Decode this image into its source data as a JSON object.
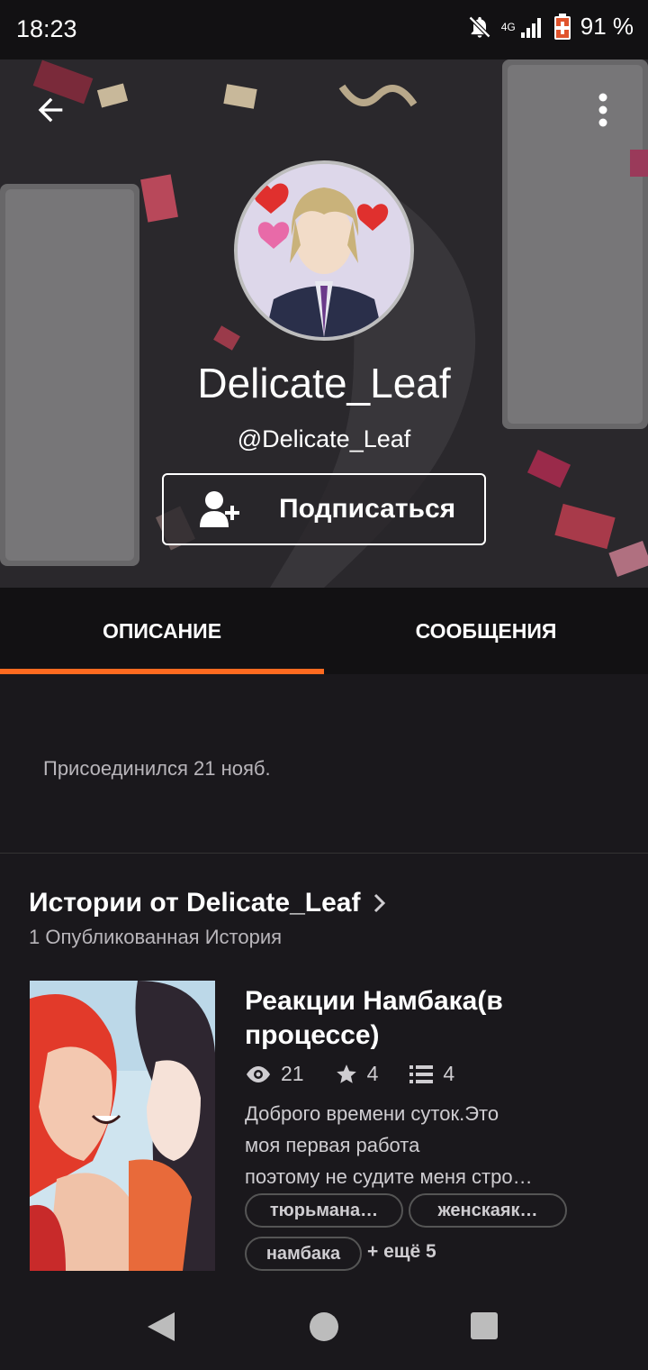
{
  "status_bar": {
    "time": "18:23",
    "network": "4G",
    "battery": "91 %"
  },
  "profile": {
    "display_name": "Delicate_Leaf",
    "handle": "@Delicate_Leaf",
    "follow_label": "Подписаться"
  },
  "tabs": [
    {
      "label": "ОПИСАНИЕ",
      "active": true
    },
    {
      "label": "СООБЩЕНИЯ",
      "active": false
    }
  ],
  "about": {
    "joined": "Присоединился 21 нояб."
  },
  "stories": {
    "title": "Истории от Delicate_Leaf",
    "count": "1 Опубликованная История",
    "items": [
      {
        "title": "Реакции Намбака(в процессе)",
        "reads": "21",
        "votes": "4",
        "parts": "4",
        "description_lines": [
          "Доброго времени суток.Это",
          "моя первая работа",
          "поэтому не судите  меня стро…"
        ],
        "tags": [
          "тюрьмана…",
          "женскаяк…",
          "намбака"
        ],
        "more_tags": "+ ещё 5"
      }
    ]
  },
  "colors": {
    "accent": "#ff6a20",
    "background": "#1a181c",
    "tab_background": "#121113"
  }
}
